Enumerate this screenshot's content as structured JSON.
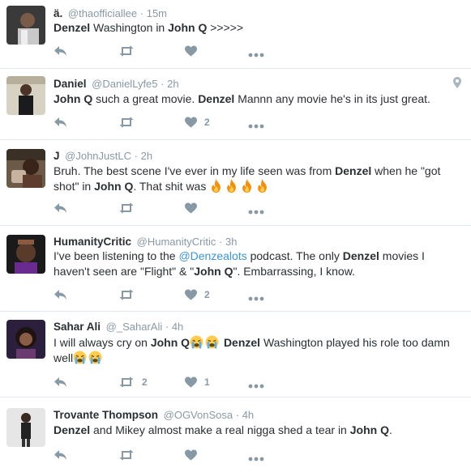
{
  "colors": {
    "text": "#292f33",
    "muted": "#8899a6",
    "link": "#3b94d9",
    "fire": "#f4900c",
    "divider": "#e1e8ed"
  },
  "tweets": [
    {
      "name": "ä.",
      "handle": "@thaofficiallee",
      "time": "15m",
      "segments": [
        {
          "t": "Denzel",
          "b": true
        },
        {
          "t": " Washington in "
        },
        {
          "t": "John Q",
          "b": true
        },
        {
          "t": " >>>>>"
        }
      ],
      "retweets": "",
      "likes": ""
    },
    {
      "name": "Daniel",
      "handle": "@DanielLyfe5",
      "time": "2h",
      "has_location": true,
      "segments": [
        {
          "t": "John Q",
          "b": true
        },
        {
          "t": " such a great movie. "
        },
        {
          "t": "Denzel",
          "b": true
        },
        {
          "t": " Mannn any movie he's in its just great."
        }
      ],
      "retweets": "",
      "likes": "2"
    },
    {
      "name": "J",
      "handle": "@JohnJustLC",
      "time": "2h",
      "segments": [
        {
          "t": "Bruh. The best scene I've ever in my life seen was from "
        },
        {
          "t": "Denzel",
          "b": true
        },
        {
          "t": " when he \"got shot\" in "
        },
        {
          "t": "John Q",
          "b": true
        },
        {
          "t": ". That shit was "
        }
      ],
      "emoji_after": [
        "fire-emoji",
        "fire-emoji",
        "fire-emoji",
        "fire-emoji"
      ],
      "retweets": "",
      "likes": ""
    },
    {
      "name": "HumanityCritic",
      "handle": "@HumanityCritic",
      "time": "3h",
      "segments": [
        {
          "t": "I've been listening to the "
        },
        {
          "t": "@Denzealots",
          "m": true
        },
        {
          "t": " podcast. The only "
        },
        {
          "t": "Denzel",
          "b": true
        },
        {
          "t": " movies I haven't seen are \"Flight\" & \""
        },
        {
          "t": "John Q",
          "b": true
        },
        {
          "t": "\". Embarrassing, I know."
        }
      ],
      "retweets": "",
      "likes": "2"
    },
    {
      "name": "Sahar Ali",
      "handle": "@_SaharAli",
      "time": "4h",
      "segments": [
        {
          "t": "I will always cry on "
        },
        {
          "t": "John Q",
          "b": true
        },
        {
          "e": "crying-emoji"
        },
        {
          "e": "crying-emoji"
        },
        {
          "t": " "
        },
        {
          "t": "Denzel",
          "b": true
        },
        {
          "t": " Washington played his role too damn well"
        },
        {
          "e": "crying-emoji"
        },
        {
          "e": "crying-emoji"
        }
      ],
      "retweets": "2",
      "likes": "1"
    },
    {
      "name": "Trovante Thompson",
      "handle": "@OGVonSosa",
      "time": "4h",
      "segments": [
        {
          "t": "Denzel",
          "b": true
        },
        {
          "t": " and Mikey almost make a real nigga shed a tear in "
        },
        {
          "t": "John Q",
          "b": true
        },
        {
          "t": "."
        }
      ],
      "retweets": "",
      "likes": ""
    }
  ]
}
